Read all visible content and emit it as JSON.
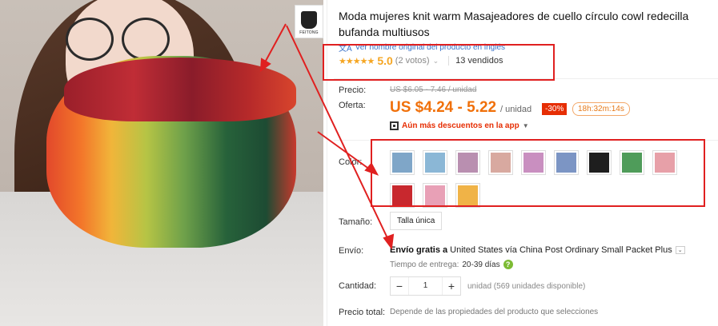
{
  "product": {
    "title": "Moda mujeres knit warm Masajeadores de cuello círculo cowl redecilla bufanda multiusos",
    "translate_link": "Ver nombre original del producto en inglés",
    "brand_label": "FEITONG"
  },
  "rating": {
    "stars": "★★★★★",
    "score": "5.0",
    "votes": "(2 votos)",
    "sold": "13 vendidos"
  },
  "price": {
    "label": "Precio:",
    "original": "US $6.05 - 7.46 / unidad",
    "offer_label": "Oferta:",
    "offer": "US $4.24 - 5.22",
    "per_unit": "/ unidad",
    "discount": "-30%",
    "timer": "18h:32m:14s",
    "app_promo": "Aún más descuentos en la app"
  },
  "color": {
    "label": "Color:",
    "swatch_colors": [
      "#7fa6c8",
      "#8bb7d6",
      "#b98fb0",
      "#d8a9a0",
      "#c98fc0",
      "#7c95c4",
      "#1e1e1e",
      "#4f9c5a",
      "#e7a0a8",
      "#c8282e",
      "#e8a0b6",
      "#f0b347"
    ]
  },
  "size": {
    "label": "Tamaño:",
    "value": "Talla única"
  },
  "shipping": {
    "label": "Envío:",
    "free": "Envío gratis a",
    "dest": "United States vía China Post Ordinary Small Packet Plus",
    "delivery_label": "Tiempo de entrega:",
    "delivery_days": "20-39 días"
  },
  "quantity": {
    "label": "Cantidad:",
    "minus": "−",
    "value": "1",
    "plus": "+",
    "available": "unidad (569 unidades disponible)"
  },
  "total": {
    "label": "Precio total:",
    "text": "Depende de las propiedades del producto que selecciones"
  }
}
